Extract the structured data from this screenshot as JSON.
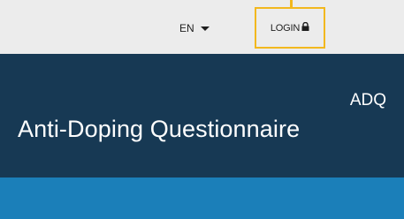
{
  "topbar": {
    "language": "EN",
    "login_label": "LOGIN",
    "login_icon": "lock-icon",
    "highlight_color": "#f2b81e"
  },
  "header": {
    "abbreviation": "ADQ",
    "title": "Anti-Doping Questionnaire",
    "background_color": "#173954"
  },
  "band": {
    "background_color": "#1b7fb9"
  }
}
